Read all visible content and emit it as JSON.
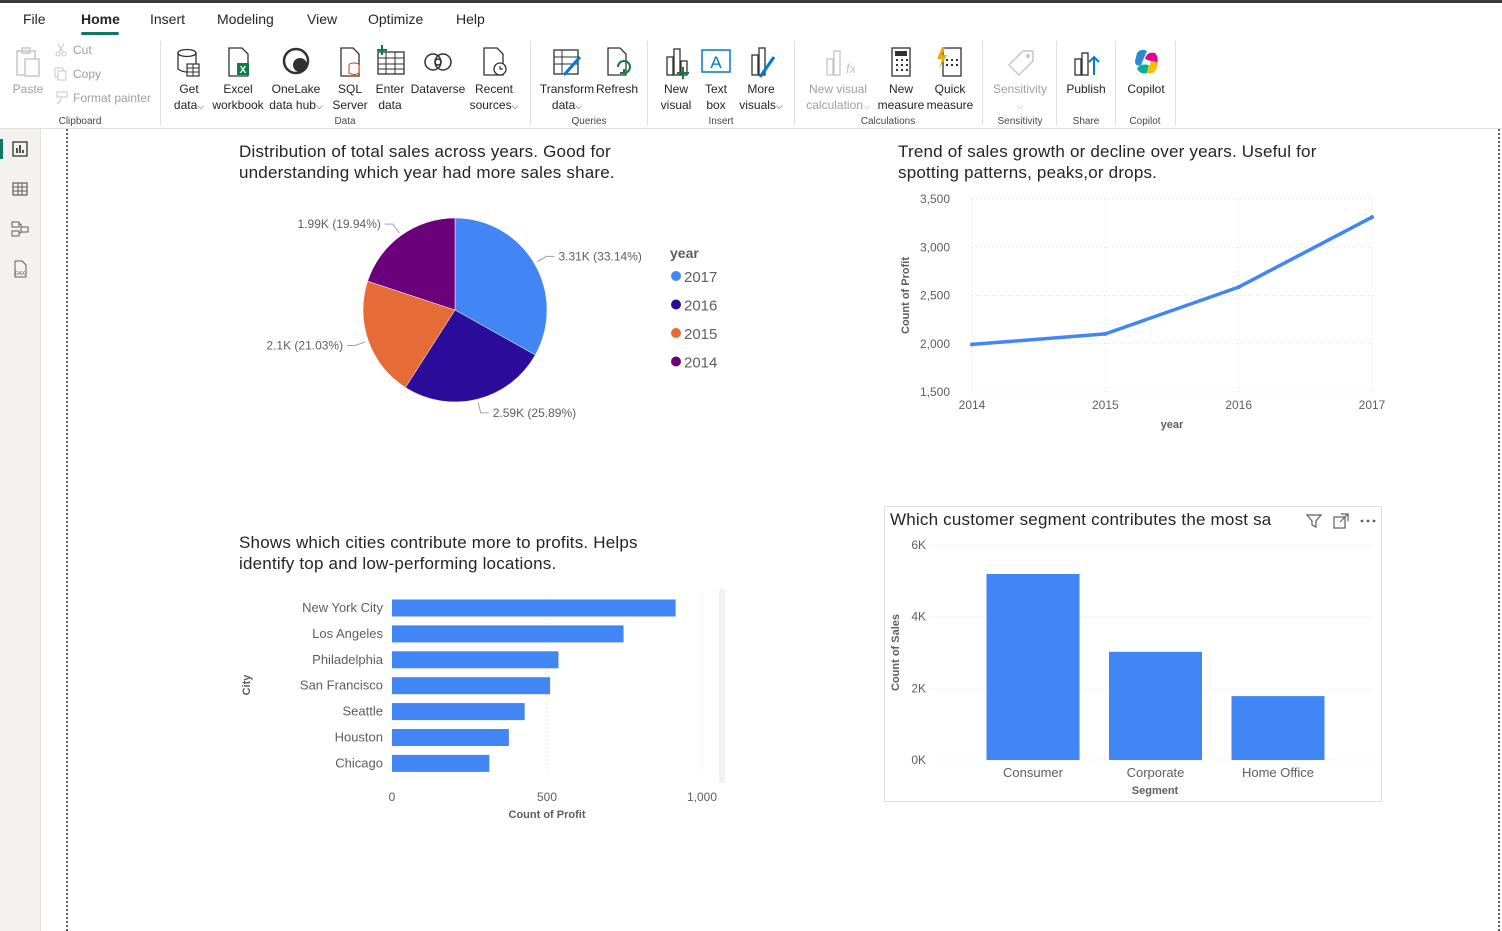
{
  "menu": {
    "tabs": [
      "File",
      "Home",
      "Insert",
      "Modeling",
      "View",
      "Optimize",
      "Help"
    ],
    "active": "Home"
  },
  "ribbon": {
    "clipboard": {
      "paste": "Paste",
      "cut": "Cut",
      "copy": "Copy",
      "format_painter": "Format painter",
      "group": "Clipboard"
    },
    "data": {
      "get_data_1": "Get",
      "get_data_2": "data",
      "excel_1": "Excel",
      "excel_2": "workbook",
      "onelake_1": "OneLake",
      "onelake_2": "data hub",
      "sql_1": "SQL",
      "sql_2": "Server",
      "enter_1": "Enter",
      "enter_2": "data",
      "dataverse": "Dataverse",
      "recent_1": "Recent",
      "recent_2": "sources",
      "group": "Data"
    },
    "queries": {
      "transform_1": "Transform",
      "transform_2": "data",
      "refresh": "Refresh",
      "group": "Queries"
    },
    "insert": {
      "new_visual_1": "New",
      "new_visual_2": "visual",
      "text_box_1": "Text",
      "text_box_2": "box",
      "more_visuals_1": "More",
      "more_visuals_2": "visuals",
      "group": "Insert"
    },
    "calculations": {
      "new_visual_calc_1": "New visual",
      "new_visual_calc_2": "calculation",
      "new_measure_1": "New",
      "new_measure_2": "measure",
      "quick_measure_1": "Quick",
      "quick_measure_2": "measure",
      "group": "Calculations"
    },
    "sensitivity": {
      "label": "Sensitivity",
      "group": "Sensitivity"
    },
    "share": {
      "publish": "Publish",
      "group": "Share"
    },
    "copilot": {
      "label": "Copilot",
      "group": "Copilot"
    }
  },
  "visuals": {
    "pie_title_1": "Distribution of total sales across years. Good for",
    "pie_title_2": "understanding which year had more sales share.",
    "line_title_1": "Trend of sales growth or decline over years. Useful for",
    "line_title_2": "spotting patterns, peaks,or drops.",
    "bar_title_1": "Shows which cities contribute more to profits. Helps",
    "bar_title_2": "identify top and low-performing locations.",
    "col_title": "Which customer segment contributes the most sa"
  },
  "chart_data": [
    {
      "type": "pie",
      "legend_title": "year",
      "legend_position": "right",
      "slices": [
        {
          "label": "2017",
          "value": 3310,
          "display": "3.31K (33.14%)",
          "color": "#4285f4"
        },
        {
          "label": "2016",
          "value": 2590,
          "display": "2.59K (25.89%)",
          "color": "#2c0c9a"
        },
        {
          "label": "2015",
          "value": 2100,
          "display": "2.1K (21.03%)",
          "color": "#e66c37"
        },
        {
          "label": "2014",
          "value": 1990,
          "display": "1.99K (19.94%)",
          "color": "#6b007b"
        }
      ]
    },
    {
      "type": "line",
      "x": [
        2014,
        2015,
        2016,
        2017
      ],
      "x_ticks": [
        "2014",
        "2015",
        "2016",
        "2017"
      ],
      "y": [
        1993,
        2102,
        2587,
        3312
      ],
      "ylim": [
        1500,
        3500
      ],
      "y_ticks": [
        "1,500",
        "2,000",
        "2,500",
        "3,000",
        "3,500"
      ],
      "y_tick_values": [
        1500,
        2000,
        2500,
        3000,
        3500
      ],
      "xlabel": "year",
      "ylabel": "Count of Profit",
      "color": "#4285f4",
      "grid": true
    },
    {
      "type": "bar",
      "orientation": "horizontal",
      "categories": [
        "New York City",
        "Los Angeles",
        "Philadelphia",
        "San Francisco",
        "Seattle",
        "Houston",
        "Chicago"
      ],
      "values": [
        915,
        747,
        537,
        510,
        428,
        377,
        314
      ],
      "xlim": [
        0,
        1000
      ],
      "x_ticks": [
        "0",
        "500",
        "1,000"
      ],
      "x_tick_values": [
        0,
        500,
        1000
      ],
      "xlabel": "Count of Profit",
      "ylabel": "City",
      "color": "#4285f4",
      "grid": true
    },
    {
      "type": "bar",
      "orientation": "vertical",
      "categories": [
        "Consumer",
        "Corporate",
        "Home Office"
      ],
      "values": [
        5191,
        3020,
        1783
      ],
      "ylim": [
        0,
        6000
      ],
      "y_ticks": [
        "0K",
        "2K",
        "4K",
        "6K"
      ],
      "y_tick_values": [
        0,
        2000,
        4000,
        6000
      ],
      "xlabel": "Segment",
      "ylabel": "Count of Sales",
      "color": "#4285f4",
      "grid": true
    }
  ]
}
